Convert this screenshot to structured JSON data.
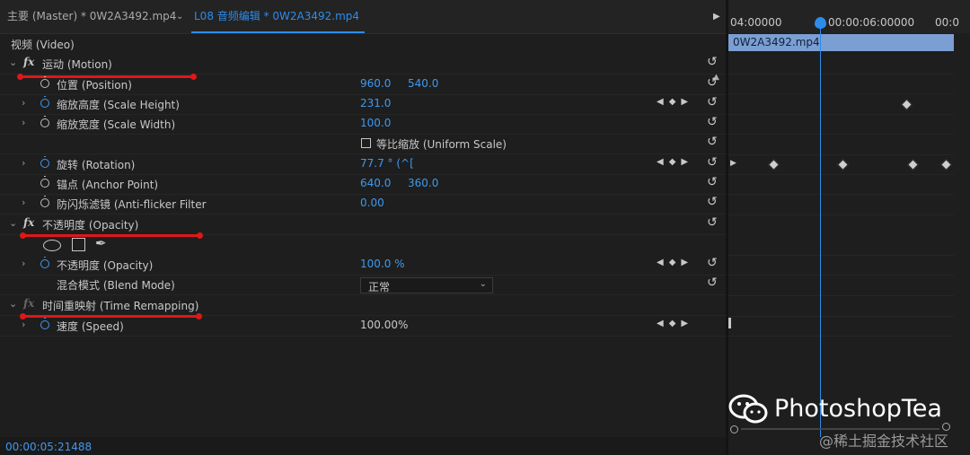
{
  "tabs": {
    "master": "主要 (Master) * 0W2A3492.mp4",
    "sequence": "L08 音频编辑 * 0W2A3492.mp4"
  },
  "section_video": "视频 (Video)",
  "effects": {
    "motion": {
      "label": "运动 (Motion)",
      "position": {
        "label": "位置 (Position)",
        "x": "960.0",
        "y": "540.0"
      },
      "scale_height": {
        "label": "缩放高度 (Scale Height)",
        "value": "231.0"
      },
      "scale_width": {
        "label": "缩放宽度 (Scale Width)",
        "value": "100.0"
      },
      "uniform_scale": {
        "label": "等比缩放 (Uniform Scale)"
      },
      "rotation": {
        "label": "旋转 (Rotation)",
        "value": "77.7 ° (^["
      },
      "anchor": {
        "label": "锚点 (Anchor Point)",
        "x": "640.0",
        "y": "360.0"
      },
      "anti_flicker": {
        "label": "防闪烁滤镜 (Anti-flicker Filter",
        "value": "0.00"
      }
    },
    "opacity": {
      "label": "不透明度 (Opacity)",
      "opacity": {
        "label": "不透明度 (Opacity)",
        "value": "100.0 %"
      },
      "blend": {
        "label": "混合模式 (Blend Mode)",
        "value": "正常"
      }
    },
    "time_remap": {
      "label": "时间重映射 (Time Remapping)",
      "speed": {
        "label": "速度 (Speed)",
        "value": "100.00%"
      }
    }
  },
  "status": {
    "timecode": "00:00:05:21488"
  },
  "timeline": {
    "tick1": "04:00000",
    "tick2": "00:00:06:00000",
    "tick3": "00:0",
    "clip_name": "0W2A3492.mp4"
  },
  "watermark": {
    "brand": "PhotoshopTea",
    "site": "@稀土掘金技术社区"
  },
  "colors": {
    "accent": "#2d8ceb",
    "annotation": "#e01717",
    "clip": "#7b9fd2"
  }
}
